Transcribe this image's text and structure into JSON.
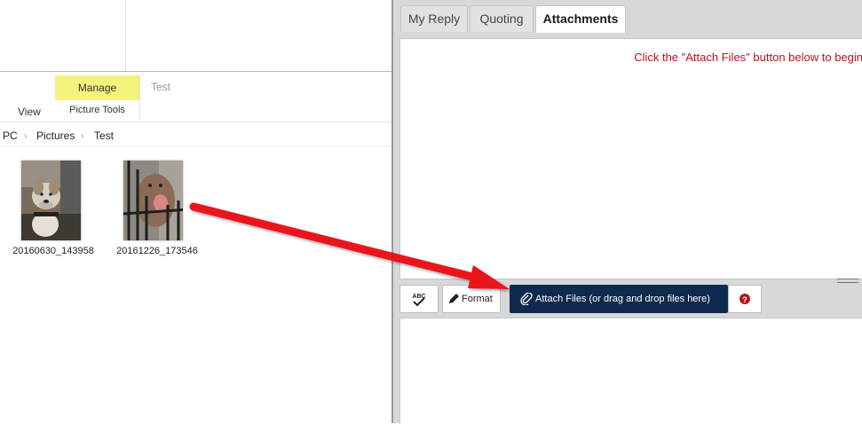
{
  "explorer": {
    "ribbon": {
      "view_tab": "View",
      "manage_tab": "Manage",
      "picture_tools": "Picture Tools",
      "test_tab": "Test"
    },
    "breadcrumb": [
      "PC",
      "Pictures",
      "Test"
    ],
    "files": [
      {
        "name": "20160630_143958",
        "icon": "dog-photo-thumbnail"
      },
      {
        "name": "20161226_173546",
        "icon": "dog-photo-thumbnail"
      }
    ]
  },
  "panel": {
    "tabs": [
      "My Reply",
      "Quoting",
      "Attachments"
    ],
    "active_tab": "Attachments",
    "instruction": "Click the \"Attach Files\" button below to begin",
    "toolbar": {
      "spellcheck_icon": "abc-spellcheck-icon",
      "format_label": "Format",
      "attach_label": "Attach Files (or drag and drop files here)",
      "help_icon": "question-circle-icon"
    }
  },
  "colors": {
    "manage_highlight": "#f4f37e",
    "attach_button": "#0e2a4d",
    "instruction_text": "#c0101a",
    "arrow": "#e8141c"
  }
}
